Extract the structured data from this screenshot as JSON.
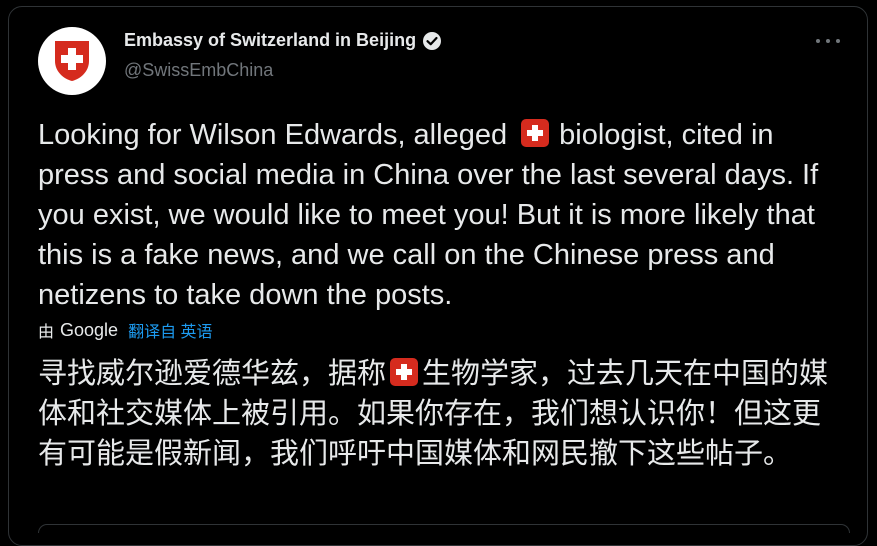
{
  "account": {
    "display_name": "Embassy of Switzerland in Beijing",
    "handle": "@SwissEmbChina",
    "verified": true,
    "avatar_icon": "swiss-shield",
    "avatar_color": "#d52b1e"
  },
  "tweet": {
    "text_before_flag": "Looking for Wilson Edwards, alleged ",
    "flag_icon": "swiss-flag-emoji",
    "text_after_flag": "biologist, cited in press and social media in China over the last several days. If you exist, we would like to meet you! But it is more likely that this is a fake news, and we call on the Chinese press and netizens to take down the posts."
  },
  "translation": {
    "by_label": "由",
    "provider": "Google",
    "link_label": "翻译自 英语",
    "text_before_flag": "寻找威尔逊爱德华兹，据称",
    "text_after_flag": "生物学家，过去几天在中国的媒体和社交媒体上被引用。如果你存在，我们想认识你！但这更有可能是假新闻，我们呼吁中国媒体和网民撤下这些帖子。"
  },
  "menu": {
    "icon": "more-options-icon"
  },
  "colors": {
    "background": "#000000",
    "text": "#e7e9ea",
    "secondary_text": "#71767b",
    "link": "#1d9bf0",
    "swiss_red": "#d52b1e"
  }
}
